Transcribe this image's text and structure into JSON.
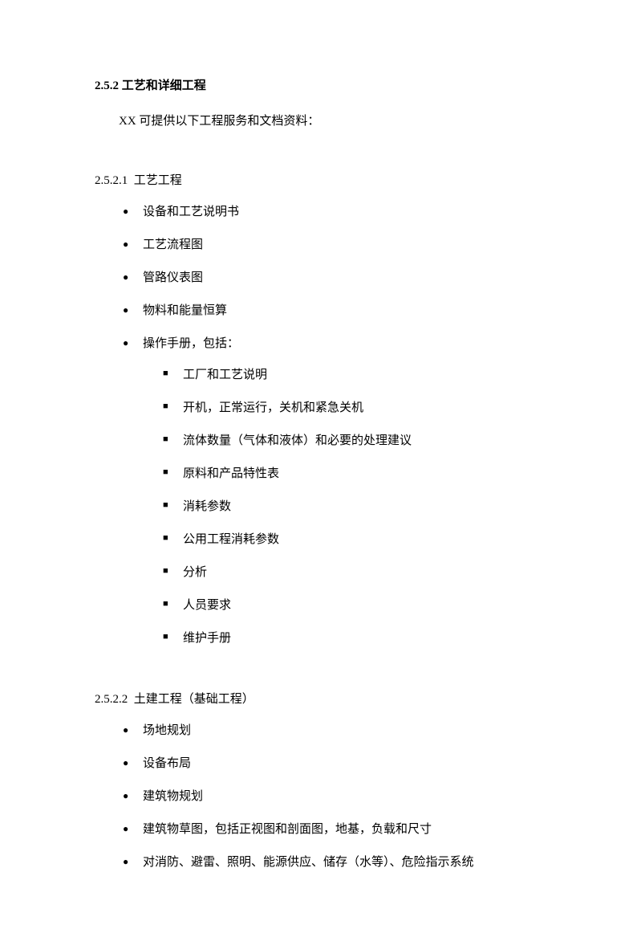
{
  "section": {
    "number": "2.5.2",
    "title": "工艺和详细工程",
    "intro": "XX 可提供以下工程服务和文档资料："
  },
  "subsections": [
    {
      "number": "2.5.2.1",
      "title": "工艺工程",
      "items": [
        {
          "text": "设备和工艺说明书"
        },
        {
          "text": "工艺流程图"
        },
        {
          "text": "管路仪表图"
        },
        {
          "text": "物料和能量恒算"
        },
        {
          "text": "操作手册，包括：",
          "subitems": [
            "工厂和工艺说明",
            "开机，正常运行，关机和紧急关机",
            "流体数量（气体和液体）和必要的处理建议",
            "原料和产品特性表",
            "消耗参数",
            "公用工程消耗参数",
            "分析",
            "人员要求",
            "维护手册"
          ]
        }
      ]
    },
    {
      "number": "2.5.2.2",
      "title": "土建工程（基础工程）",
      "items": [
        {
          "text": "场地规划"
        },
        {
          "text": "设备布局"
        },
        {
          "text": "建筑物规划"
        },
        {
          "text": "建筑物草图，包括正视图和剖面图，地基，负载和尺寸"
        },
        {
          "text": "对消防、避雷、照明、能源供应、储存（水等）、危险指示系统"
        }
      ]
    }
  ]
}
